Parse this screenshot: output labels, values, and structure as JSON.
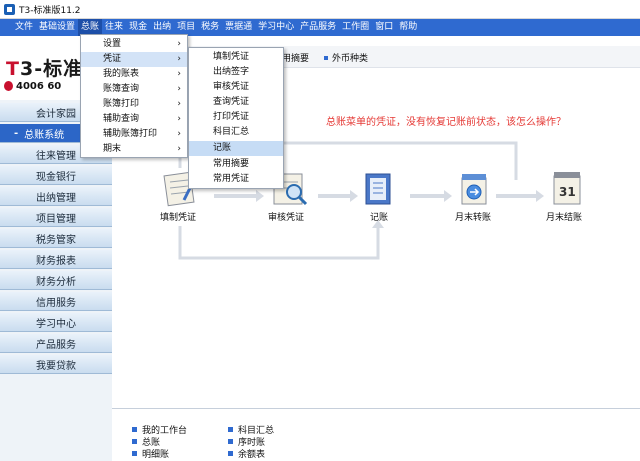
{
  "window": {
    "title": "T3-标准版11.2"
  },
  "menubar": [
    "文件",
    "基础设置",
    "总账",
    "往来",
    "现金",
    "出纳",
    "项目",
    "税务",
    "票据通",
    "学习中心",
    "产品服务",
    "工作圈",
    "窗口",
    "帮助"
  ],
  "logo": {
    "brand_t": "T",
    "brand_rest": "3-标准",
    "phone": "4006 60"
  },
  "toolbar": {
    "item1": "用摘要",
    "item2": "外币种类"
  },
  "sidebar": [
    "会计家园",
    "总账系统",
    "往来管理",
    "现金银行",
    "出纳管理",
    "项目管理",
    "税务管家",
    "财务报表",
    "财务分析",
    "信用服务",
    "学习中心",
    "产品服务",
    "我要贷款"
  ],
  "menu_gl": [
    {
      "label": "设置",
      "arrow": "›"
    },
    {
      "label": "凭证",
      "arrow": "›"
    },
    {
      "label": "我的账表",
      "arrow": "›"
    },
    {
      "label": "账簿查询",
      "arrow": "›"
    },
    {
      "label": "账簿打印",
      "arrow": "›"
    },
    {
      "label": "辅助查询",
      "arrow": "›"
    },
    {
      "label": "辅助账簿打印",
      "arrow": "›"
    },
    {
      "label": "期末",
      "arrow": "›"
    }
  ],
  "menu_voucher": [
    "填制凭证",
    "出纳签字",
    "审核凭证",
    "查询凭证",
    "打印凭证",
    "科目汇总",
    "记账",
    "常用摘要",
    "常用凭证"
  ],
  "main": {
    "question": "总账菜单的凭证，没有恢复记账前状态，该怎么操作？",
    "flow": [
      "填制凭证",
      "审核凭证",
      "记账",
      "月末转账",
      "月末结账"
    ]
  },
  "bottom": {
    "col1": [
      "我的工作台",
      "总账",
      "明细账"
    ],
    "col2": [
      "科目汇总",
      "序时账",
      "余额表"
    ]
  },
  "colors": {
    "menubar": "#2f6ad0",
    "sidebar_active": "#2c66c7",
    "question": "#e53935",
    "brand": "#c8102e"
  }
}
